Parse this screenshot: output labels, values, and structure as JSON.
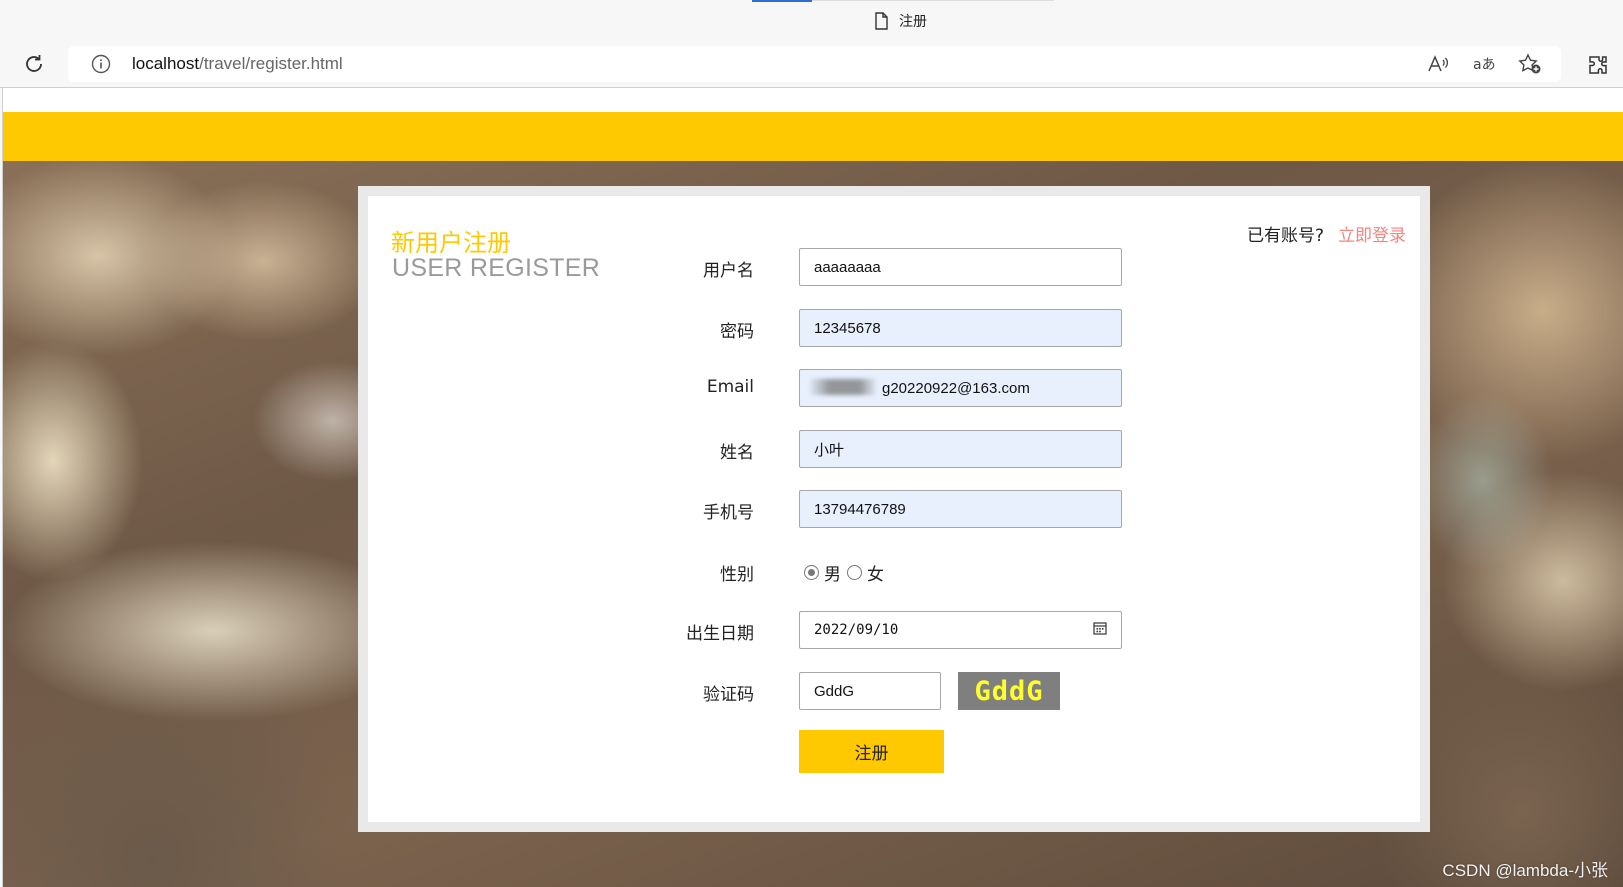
{
  "browser": {
    "tab_title": "注册",
    "url_host": "localhost",
    "url_path": "/travel/register.html",
    "accent_color": "#2b6fd4"
  },
  "page": {
    "header_color": "#ffc900",
    "watermark": "CSDN @lambda-小张"
  },
  "register": {
    "title_zh": "新用户注册",
    "title_en": "USER REGISTER",
    "login_hint": "已有账号?",
    "login_link": "立即登录",
    "fields": {
      "username": {
        "label": "用户名",
        "value": "aaaaaaaa"
      },
      "password": {
        "label": "密码",
        "value": "12345678"
      },
      "email": {
        "label": "Email",
        "value": "g20220922@163.com"
      },
      "name": {
        "label": "姓名",
        "value": "小叶"
      },
      "phone": {
        "label": "手机号",
        "value": "13794476789"
      },
      "gender": {
        "label": "性别",
        "options": [
          "男",
          "女"
        ],
        "selected": "男"
      },
      "birthday": {
        "label": "出生日期",
        "value": "2022/09/10"
      },
      "captcha": {
        "label": "验证码",
        "value": "GddG",
        "image_text": "GddG"
      }
    },
    "submit_label": "注册"
  }
}
